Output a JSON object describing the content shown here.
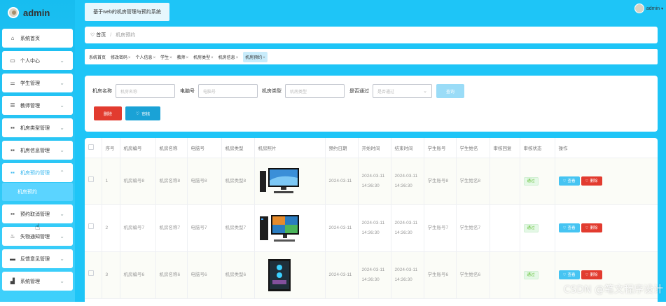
{
  "sidebar": {
    "username": "admin",
    "items": [
      {
        "icon": "home-icon",
        "glyph": "⌂",
        "label": "系统首页",
        "chevron": false
      },
      {
        "icon": "calendar-icon",
        "glyph": "▭",
        "label": "个人中心",
        "chevron": true
      },
      {
        "icon": "sliders-icon",
        "glyph": "⚌",
        "label": "学生管理",
        "chevron": true
      },
      {
        "icon": "list-icon",
        "glyph": "☰",
        "label": "教师管理",
        "chevron": true
      },
      {
        "icon": "grid-icon",
        "glyph": "▪▪",
        "label": "机房类型管理",
        "chevron": true
      },
      {
        "icon": "grid-icon",
        "glyph": "▪▪",
        "label": "机房信息管理",
        "chevron": true
      },
      {
        "icon": "grid-icon",
        "glyph": "▪▪",
        "label": "机房预约管理",
        "chevron": true,
        "open": true
      },
      {
        "icon": "grid-icon",
        "glyph": "▪▪",
        "label": "预约取消管理",
        "chevron": true
      },
      {
        "icon": "bulb-icon",
        "glyph": "♨",
        "label": "失物通知管理",
        "chevron": true
      },
      {
        "icon": "chat-icon",
        "glyph": "▬",
        "label": "反馈意见管理",
        "chevron": true
      },
      {
        "icon": "chart-icon",
        "glyph": "▟",
        "label": "系统管理",
        "chevron": true
      }
    ],
    "submenu_label": "机房预约"
  },
  "header": {
    "system_title": "基于web的机房管理与预约系统",
    "user_label": "admin"
  },
  "breadcrumb": {
    "home": "首页",
    "current": "机房预约"
  },
  "tags": [
    {
      "label": "系统首页",
      "closable": false
    },
    {
      "label": "修改密码",
      "closable": true
    },
    {
      "label": "个人信息",
      "closable": true
    },
    {
      "label": "学生",
      "closable": true
    },
    {
      "label": "教师",
      "closable": true
    },
    {
      "label": "机房类型",
      "closable": true
    },
    {
      "label": "机房信息",
      "closable": true
    },
    {
      "label": "机房预约",
      "closable": true,
      "active": true
    }
  ],
  "search": {
    "room_name_label": "机房名称",
    "room_name_placeholder": "机房名称",
    "pc_no_label": "电脑号",
    "pc_no_placeholder": "电脑号",
    "room_type_label": "机房类型",
    "room_type_placeholder": "机房类型",
    "pass_label": "是否通过",
    "pass_placeholder": "是否通过",
    "query_button": "查询",
    "delete_button": "删除",
    "audit_button": "审核"
  },
  "table": {
    "columns": [
      "",
      "序号",
      "机房编号",
      "机房名称",
      "电脑号",
      "机房类型",
      "机房照片",
      "预约日期",
      "开始时间",
      "结束时间",
      "学生账号",
      "学生姓名",
      "审核回复",
      "审核状态",
      "操作"
    ],
    "rows": [
      {
        "index": "1",
        "room_no": "机房编号8",
        "room_name": "机房名称8",
        "pc_no": "电脑号8",
        "room_type": "机房类型8",
        "date": "2024-03-11",
        "start": "2024-03-11 14:36:30",
        "end": "2024-03-11 14:36:30",
        "student_no": "学生账号8",
        "student_name": "学生姓名8",
        "reply": "",
        "status": "通过",
        "view": "查看",
        "delete": "删除"
      },
      {
        "index": "2",
        "room_no": "机房编号7",
        "room_name": "机房名称7",
        "pc_no": "电脑号7",
        "room_type": "机房类型7",
        "date": "2024-03-11",
        "start": "2024-03-11 14:36:30",
        "end": "2024-03-11 14:36:30",
        "student_no": "学生账号7",
        "student_name": "学生姓名7",
        "reply": "",
        "status": "通过",
        "view": "查看",
        "delete": "删除"
      },
      {
        "index": "3",
        "room_no": "机房编号6",
        "room_name": "机房名称6",
        "pc_no": "电脑号6",
        "room_type": "机房类型6",
        "date": "2024-03-11",
        "start": "2024-03-11 14:36:30",
        "end": "2024-03-11 14:36:30",
        "student_no": "学生账号6",
        "student_name": "学生姓名6",
        "reply": "",
        "status": "通过",
        "view": "查看",
        "delete": "删除"
      }
    ]
  },
  "watermark": "CSDN @笔文程序设计",
  "colors": {
    "accent": "#1ec5f7",
    "danger": "#e23b2f",
    "primary": "#1aa2d6",
    "success": "#67c23a"
  }
}
